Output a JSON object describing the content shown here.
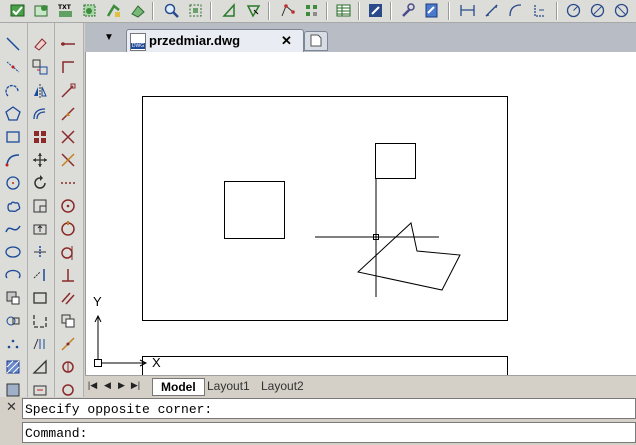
{
  "toolbar": {
    "icons": [
      "layer-properties-icon",
      "layer-state-icon",
      "txt-export-icon",
      "match-properties-icon",
      "copy-clip-icon",
      "paste-icon",
      "zoom-icon",
      "zoom-window-icon",
      "triangle-icon",
      "pan-icon",
      "polyline-node-icon",
      "dimension-style-icon",
      "table-icon",
      "tool-palette-icon",
      "properties-wrench-icon",
      "design-center-icon",
      "linear-dim-icon",
      "aligned-dim-icon",
      "arc-dim-icon",
      "ordinate-dim-icon",
      "radius-dim-icon",
      "diameter-dim-icon",
      "jogged-dim-icon"
    ],
    "txt_badge": "TXT"
  },
  "tabs": {
    "menu_arrow": "▼",
    "active_tab": "przedmiar.dwg",
    "close": "✕",
    "dwg_badge": "DWG"
  },
  "ucs": {
    "x_label": "X",
    "y_label": "Y"
  },
  "layout_tabs": {
    "nav": [
      "|◀",
      "◀",
      "▶",
      "▶|"
    ],
    "items": [
      "Model",
      "Layout1",
      "Layout2"
    ],
    "active": "Model"
  },
  "command": {
    "close_icon": "✕",
    "history": "Specify opposite corner:",
    "prompt": "Command:"
  }
}
